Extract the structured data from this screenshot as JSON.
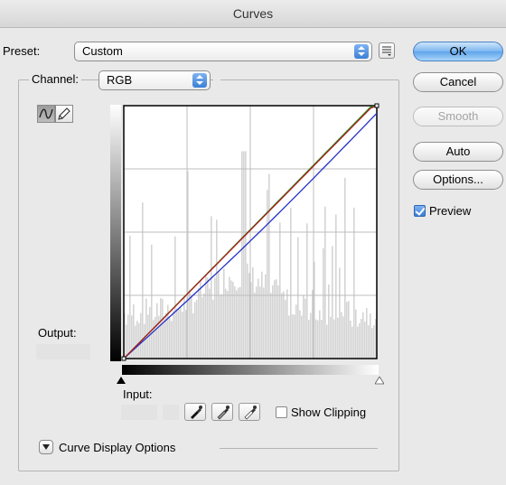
{
  "window": {
    "title": "Curves"
  },
  "preset": {
    "label": "Preset:",
    "value": "Custom"
  },
  "channel": {
    "label": "Channel:",
    "value": "RGB"
  },
  "buttons": {
    "ok": "OK",
    "cancel": "Cancel",
    "smooth": "Smooth",
    "auto": "Auto",
    "options": "Options..."
  },
  "preview": {
    "label": "Preview",
    "checked": true
  },
  "output": {
    "label": "Output:"
  },
  "input": {
    "label": "Input:"
  },
  "show_clipping": {
    "label": "Show Clipping",
    "checked": false
  },
  "curve_display_options": {
    "label": "Curve Display Options"
  },
  "icons": {
    "preset_menu": "preset-options-icon",
    "curve_tool": "curve-point-icon",
    "pencil_tool": "pencil-icon",
    "eyedroppers": [
      "black-point-eyedropper-icon",
      "gray-point-eyedropper-icon",
      "white-point-eyedropper-icon"
    ],
    "disclosure": "disclosure-triangle-icon"
  },
  "colors": {
    "red_curve": "#b01818",
    "green_curve": "#1f9a28",
    "blue_curve": "#2430c8",
    "histogram": "#d4d4d4",
    "default_button": "#5ea4ec"
  }
}
